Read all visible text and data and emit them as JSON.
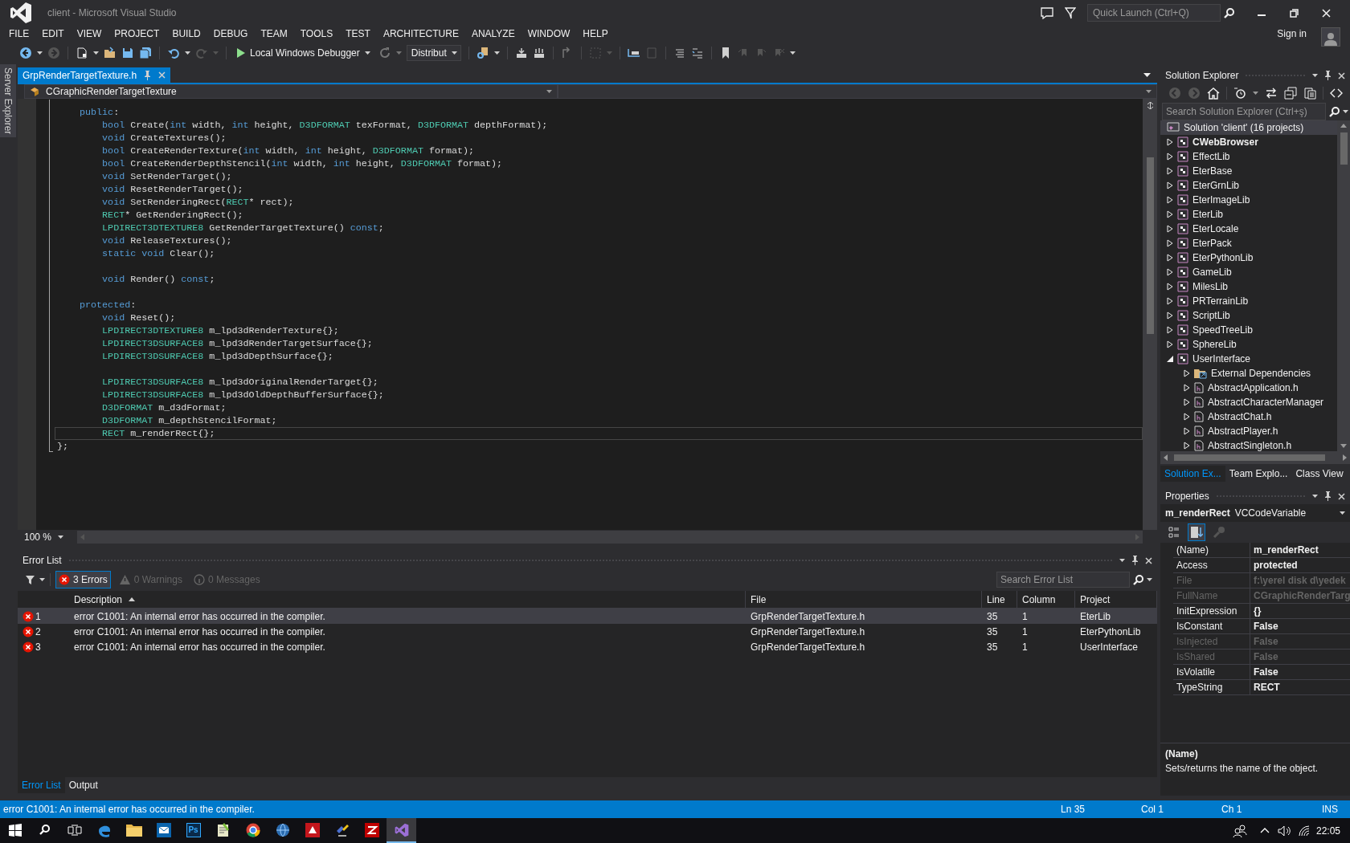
{
  "window": {
    "title": "client - Microsoft Visual Studio"
  },
  "title_bar": {
    "quick_launch": {
      "placeholder": "Quick Launch (Ctrl+Q)"
    }
  },
  "menu": {
    "items": [
      "FILE",
      "EDIT",
      "VIEW",
      "PROJECT",
      "BUILD",
      "DEBUG",
      "TEAM",
      "TOOLS",
      "TEST",
      "ARCHITECTURE",
      "ANALYZE",
      "WINDOW",
      "HELP"
    ],
    "sign_in": "Sign in"
  },
  "toolbar": {
    "debugger": "Local Windows Debugger",
    "configuration": "Distribut"
  },
  "side_tabs": [
    "Server Explorer"
  ],
  "editor": {
    "tabs": [
      {
        "label": "GrpRenderTargetTexture.h",
        "selected": true
      }
    ],
    "navigation": {
      "scope": "CGraphicRenderTargetTexture"
    },
    "lines": [
      {
        "kind": "code",
        "current": false,
        "tokens": [
          {
            "kind": "keyword",
            "text": "    public"
          },
          {
            "kind": "plain",
            "text": ":"
          }
        ]
      },
      {
        "kind": "code",
        "current": false,
        "tokens": [
          {
            "kind": "keyword",
            "text": "        bool"
          },
          {
            "kind": "plain",
            "text": " Create("
          },
          {
            "kind": "keyword",
            "text": "int"
          },
          {
            "kind": "plain",
            "text": " width, "
          },
          {
            "kind": "keyword",
            "text": "int"
          },
          {
            "kind": "plain",
            "text": " height, "
          },
          {
            "kind": "type",
            "text": "D3DFORMAT"
          },
          {
            "kind": "plain",
            "text": " texFormat, "
          },
          {
            "kind": "type",
            "text": "D3DFORMAT"
          },
          {
            "kind": "plain",
            "text": " depthFormat);"
          }
        ]
      },
      {
        "kind": "code",
        "current": false,
        "tokens": [
          {
            "kind": "keyword",
            "text": "        void"
          },
          {
            "kind": "plain",
            "text": " CreateTextures();"
          }
        ]
      },
      {
        "kind": "code",
        "current": false,
        "tokens": [
          {
            "kind": "keyword",
            "text": "        bool"
          },
          {
            "kind": "plain",
            "text": " CreateRenderTexture("
          },
          {
            "kind": "keyword",
            "text": "int"
          },
          {
            "kind": "plain",
            "text": " width, "
          },
          {
            "kind": "keyword",
            "text": "int"
          },
          {
            "kind": "plain",
            "text": " height, "
          },
          {
            "kind": "type",
            "text": "D3DFORMAT"
          },
          {
            "kind": "plain",
            "text": " format);"
          }
        ]
      },
      {
        "kind": "code",
        "current": false,
        "tokens": [
          {
            "kind": "keyword",
            "text": "        bool"
          },
          {
            "kind": "plain",
            "text": " CreateRenderDepthStencil("
          },
          {
            "kind": "keyword",
            "text": "int"
          },
          {
            "kind": "plain",
            "text": " width, "
          },
          {
            "kind": "keyword",
            "text": "int"
          },
          {
            "kind": "plain",
            "text": " height, "
          },
          {
            "kind": "type",
            "text": "D3DFORMAT"
          },
          {
            "kind": "plain",
            "text": " format);"
          }
        ]
      },
      {
        "kind": "code",
        "current": false,
        "tokens": [
          {
            "kind": "keyword",
            "text": "        void"
          },
          {
            "kind": "plain",
            "text": " SetRenderTarget();"
          }
        ]
      },
      {
        "kind": "code",
        "current": false,
        "tokens": [
          {
            "kind": "keyword",
            "text": "        void"
          },
          {
            "kind": "plain",
            "text": " ResetRenderTarget();"
          }
        ]
      },
      {
        "kind": "code",
        "current": false,
        "tokens": [
          {
            "kind": "keyword",
            "text": "        void"
          },
          {
            "kind": "plain",
            "text": " SetRenderingRect("
          },
          {
            "kind": "type",
            "text": "RECT"
          },
          {
            "kind": "plain",
            "text": "* rect);"
          }
        ]
      },
      {
        "kind": "code",
        "current": false,
        "tokens": [
          {
            "kind": "type",
            "text": "        RECT"
          },
          {
            "kind": "plain",
            "text": "* GetRenderingRect();"
          }
        ]
      },
      {
        "kind": "code",
        "current": false,
        "tokens": [
          {
            "kind": "type",
            "text": "        LPDIRECT3DTEXTURE8"
          },
          {
            "kind": "plain",
            "text": " GetRenderTargetTexture() "
          },
          {
            "kind": "keyword",
            "text": "const"
          },
          {
            "kind": "plain",
            "text": ";"
          }
        ]
      },
      {
        "kind": "code",
        "current": false,
        "tokens": [
          {
            "kind": "keyword",
            "text": "        void"
          },
          {
            "kind": "plain",
            "text": " ReleaseTextures();"
          }
        ]
      },
      {
        "kind": "code",
        "current": false,
        "tokens": [
          {
            "kind": "keyword",
            "text": "        static void"
          },
          {
            "kind": "plain",
            "text": " Clear();"
          }
        ]
      },
      {
        "kind": "blank",
        "current": false
      },
      {
        "kind": "code",
        "current": false,
        "tokens": [
          {
            "kind": "keyword",
            "text": "        void"
          },
          {
            "kind": "plain",
            "text": " Render() "
          },
          {
            "kind": "keyword",
            "text": "const"
          },
          {
            "kind": "plain",
            "text": ";"
          }
        ]
      },
      {
        "kind": "blank",
        "current": false
      },
      {
        "kind": "code",
        "current": false,
        "tokens": [
          {
            "kind": "keyword",
            "text": "    protected"
          },
          {
            "kind": "plain",
            "text": ":"
          }
        ]
      },
      {
        "kind": "code",
        "current": false,
        "tokens": [
          {
            "kind": "keyword",
            "text": "        void"
          },
          {
            "kind": "plain",
            "text": " Reset();"
          }
        ]
      },
      {
        "kind": "code",
        "current": false,
        "tokens": [
          {
            "kind": "type",
            "text": "        LPDIRECT3DTEXTURE8"
          },
          {
            "kind": "plain",
            "text": " m_lpd3dRenderTexture{};"
          }
        ]
      },
      {
        "kind": "code",
        "current": false,
        "tokens": [
          {
            "kind": "type",
            "text": "        LPDIRECT3DSURFACE8"
          },
          {
            "kind": "plain",
            "text": " m_lpd3dRenderTargetSurface{};"
          }
        ]
      },
      {
        "kind": "code",
        "current": false,
        "tokens": [
          {
            "kind": "type",
            "text": "        LPDIRECT3DSURFACE8"
          },
          {
            "kind": "plain",
            "text": " m_lpd3dDepthSurface{};"
          }
        ]
      },
      {
        "kind": "blank",
        "current": false
      },
      {
        "kind": "code",
        "current": false,
        "tokens": [
          {
            "kind": "type",
            "text": "        LPDIRECT3DSURFACE8"
          },
          {
            "kind": "plain",
            "text": " m_lpd3dOriginalRenderTarget{};"
          }
        ]
      },
      {
        "kind": "code",
        "current": false,
        "tokens": [
          {
            "kind": "type",
            "text": "        LPDIRECT3DSURFACE8"
          },
          {
            "kind": "plain",
            "text": " m_lpd3dOldDepthBufferSurface{};"
          }
        ]
      },
      {
        "kind": "code",
        "current": false,
        "tokens": [
          {
            "kind": "type",
            "text": "        D3DFORMAT"
          },
          {
            "kind": "plain",
            "text": " m_d3dFormat;"
          }
        ]
      },
      {
        "kind": "code",
        "current": false,
        "tokens": [
          {
            "kind": "type",
            "text": "        D3DFORMAT"
          },
          {
            "kind": "plain",
            "text": " m_depthStencilFormat;"
          }
        ]
      },
      {
        "kind": "code",
        "current": true,
        "tokens": [
          {
            "kind": "type",
            "text": "        RECT"
          },
          {
            "kind": "plain",
            "text": " m_renderRect{};"
          }
        ]
      },
      {
        "kind": "code",
        "current": false,
        "tokens": [
          {
            "kind": "plain",
            "text": "};"
          }
        ]
      }
    ],
    "zoom": "100 %"
  },
  "error_list": {
    "title": "Error List",
    "filters": [
      {
        "kind": "error",
        "label": "3 Errors",
        "selected": true
      },
      {
        "kind": "warning",
        "label": "0 Warnings",
        "selected": false
      },
      {
        "kind": "message",
        "label": "0 Messages",
        "selected": false
      }
    ],
    "search": {
      "placeholder": "Search Error List"
    },
    "columns": [
      {
        "label": "Description",
        "sorted": true
      },
      {
        "label": "File",
        "sorted": false
      },
      {
        "label": "Line",
        "sorted": false
      },
      {
        "label": "Column",
        "sorted": false
      },
      {
        "label": "Project",
        "sorted": false
      }
    ],
    "rows": [
      {
        "number": "1",
        "description": "error C1001: An internal error has occurred in the compiler.",
        "file": "GrpRenderTargetTexture.h",
        "line": "35",
        "column": "1",
        "project": "EterLib",
        "selected": true
      },
      {
        "number": "2",
        "description": "error C1001: An internal error has occurred in the compiler.",
        "file": "GrpRenderTargetTexture.h",
        "line": "35",
        "column": "1",
        "project": "EterPythonLib",
        "selected": false
      },
      {
        "number": "3",
        "description": "error C1001: An internal error has occurred in the compiler.",
        "file": "GrpRenderTargetTexture.h",
        "line": "35",
        "column": "1",
        "project": "UserInterface",
        "selected": false
      }
    ]
  },
  "bottom_tabs": [
    {
      "label": "Error List",
      "selected": true
    },
    {
      "label": "Output",
      "selected": false
    }
  ],
  "solution_explorer": {
    "title": "Solution Explorer",
    "search": {
      "placeholder": "Search Solution Explorer (Ctrl+ş)"
    },
    "tree": {
      "label": "Solution 'client' (16 projects)",
      "selected": true,
      "children": [
        {
          "kind": "project",
          "label": "CWebBrowser",
          "startup": true,
          "expanded": false,
          "selected": false
        },
        {
          "kind": "project",
          "label": "EffectLib",
          "startup": false,
          "expanded": false,
          "selected": false
        },
        {
          "kind": "project",
          "label": "EterBase",
          "startup": false,
          "expanded": false,
          "selected": false
        },
        {
          "kind": "project",
          "label": "EterGrnLib",
          "startup": false,
          "expanded": false,
          "selected": false
        },
        {
          "kind": "project",
          "label": "EterImageLib",
          "startup": false,
          "expanded": false,
          "selected": false
        },
        {
          "kind": "project",
          "label": "EterLib",
          "startup": false,
          "expanded": false,
          "selected": false
        },
        {
          "kind": "project",
          "label": "EterLocale",
          "startup": false,
          "expanded": false,
          "selected": false
        },
        {
          "kind": "project",
          "label": "EterPack",
          "startup": false,
          "expanded": false,
          "selected": false
        },
        {
          "kind": "project",
          "label": "EterPythonLib",
          "startup": false,
          "expanded": false,
          "selected": false
        },
        {
          "kind": "project",
          "label": "GameLib",
          "startup": false,
          "expanded": false,
          "selected": false
        },
        {
          "kind": "project",
          "label": "MilesLib",
          "startup": false,
          "expanded": false,
          "selected": false
        },
        {
          "kind": "project",
          "label": "PRTerrainLib",
          "startup": false,
          "expanded": false,
          "selected": false
        },
        {
          "kind": "project",
          "label": "ScriptLib",
          "startup": false,
          "expanded": false,
          "selected": false
        },
        {
          "kind": "project",
          "label": "SpeedTreeLib",
          "startup": false,
          "expanded": false,
          "selected": false
        },
        {
          "kind": "project",
          "label": "SphereLib",
          "startup": false,
          "expanded": false,
          "selected": false
        },
        {
          "kind": "project",
          "label": "UserInterface",
          "startup": false,
          "expanded": true,
          "selected": false,
          "children": [
            {
              "kind": "dependencies",
              "label": "External Dependencies",
              "startup": false,
              "expanded": false,
              "selected": false
            },
            {
              "kind": "header",
              "label": "AbstractApplication.h",
              "startup": false,
              "expanded": false,
              "selected": false
            },
            {
              "kind": "header",
              "label": "AbstractCharacterManager",
              "startup": false,
              "expanded": false,
              "selected": false
            },
            {
              "kind": "header",
              "label": "AbstractChat.h",
              "startup": false,
              "expanded": false,
              "selected": false
            },
            {
              "kind": "header",
              "label": "AbstractPlayer.h",
              "startup": false,
              "expanded": false,
              "selected": false
            },
            {
              "kind": "header",
              "label": "AbstractSingleton.h",
              "startup": false,
              "expanded": false,
              "selected": false
            }
          ]
        }
      ]
    },
    "tabs": [
      {
        "label": "Solution Ex...",
        "selected": true
      },
      {
        "label": "Team Explo...",
        "selected": false
      },
      {
        "label": "Class View",
        "selected": false
      }
    ]
  },
  "properties": {
    "title": "Properties",
    "object": {
      "name": "m_renderRect",
      "type": "VCCodeVariable"
    },
    "views": [
      {
        "kind": "categorized",
        "selected": false
      },
      {
        "kind": "alphabetical",
        "selected": true
      },
      {
        "kind": "pages",
        "selected": false
      }
    ],
    "rows": [
      {
        "name": "(Name)",
        "value": "m_renderRect",
        "disabled": false
      },
      {
        "name": "Access",
        "value": "protected",
        "disabled": false
      },
      {
        "name": "File",
        "value": "f:\\yerel disk d\\yedek",
        "disabled": true
      },
      {
        "name": "FullName",
        "value": "CGraphicRenderTarg",
        "disabled": true
      },
      {
        "name": "InitExpression",
        "value": "{}",
        "disabled": false
      },
      {
        "name": "IsConstant",
        "value": "False",
        "disabled": false
      },
      {
        "name": "IsInjected",
        "value": "False",
        "disabled": true
      },
      {
        "name": "IsShared",
        "value": "False",
        "disabled": true
      },
      {
        "name": "IsVolatile",
        "value": "False",
        "disabled": false
      },
      {
        "name": "TypeString",
        "value": "RECT",
        "disabled": false
      }
    ],
    "description": {
      "title": "(Name)",
      "text": "Sets/returns the name of the object."
    }
  },
  "status_bar": {
    "message": "error C1001: An internal error has occurred in the compiler.",
    "line": "Ln 35",
    "column": "Col 1",
    "char": "Ch 1",
    "mode": "INS"
  },
  "taskbar": {
    "apps": [
      {
        "kind": "edge",
        "selected": false
      },
      {
        "kind": "folder",
        "selected": false
      },
      {
        "kind": "mail",
        "selected": false
      },
      {
        "kind": "tile",
        "label": "Ps",
        "selected": false
      },
      {
        "kind": "notepad",
        "selected": false
      },
      {
        "kind": "round",
        "selected": false
      },
      {
        "kind": "globe",
        "selected": false
      },
      {
        "kind": "red",
        "selected": false
      },
      {
        "kind": "gadget",
        "selected": false
      },
      {
        "kind": "zigzag",
        "selected": false
      },
      {
        "kind": "studio",
        "selected": true
      }
    ],
    "clock": "22:05"
  }
}
